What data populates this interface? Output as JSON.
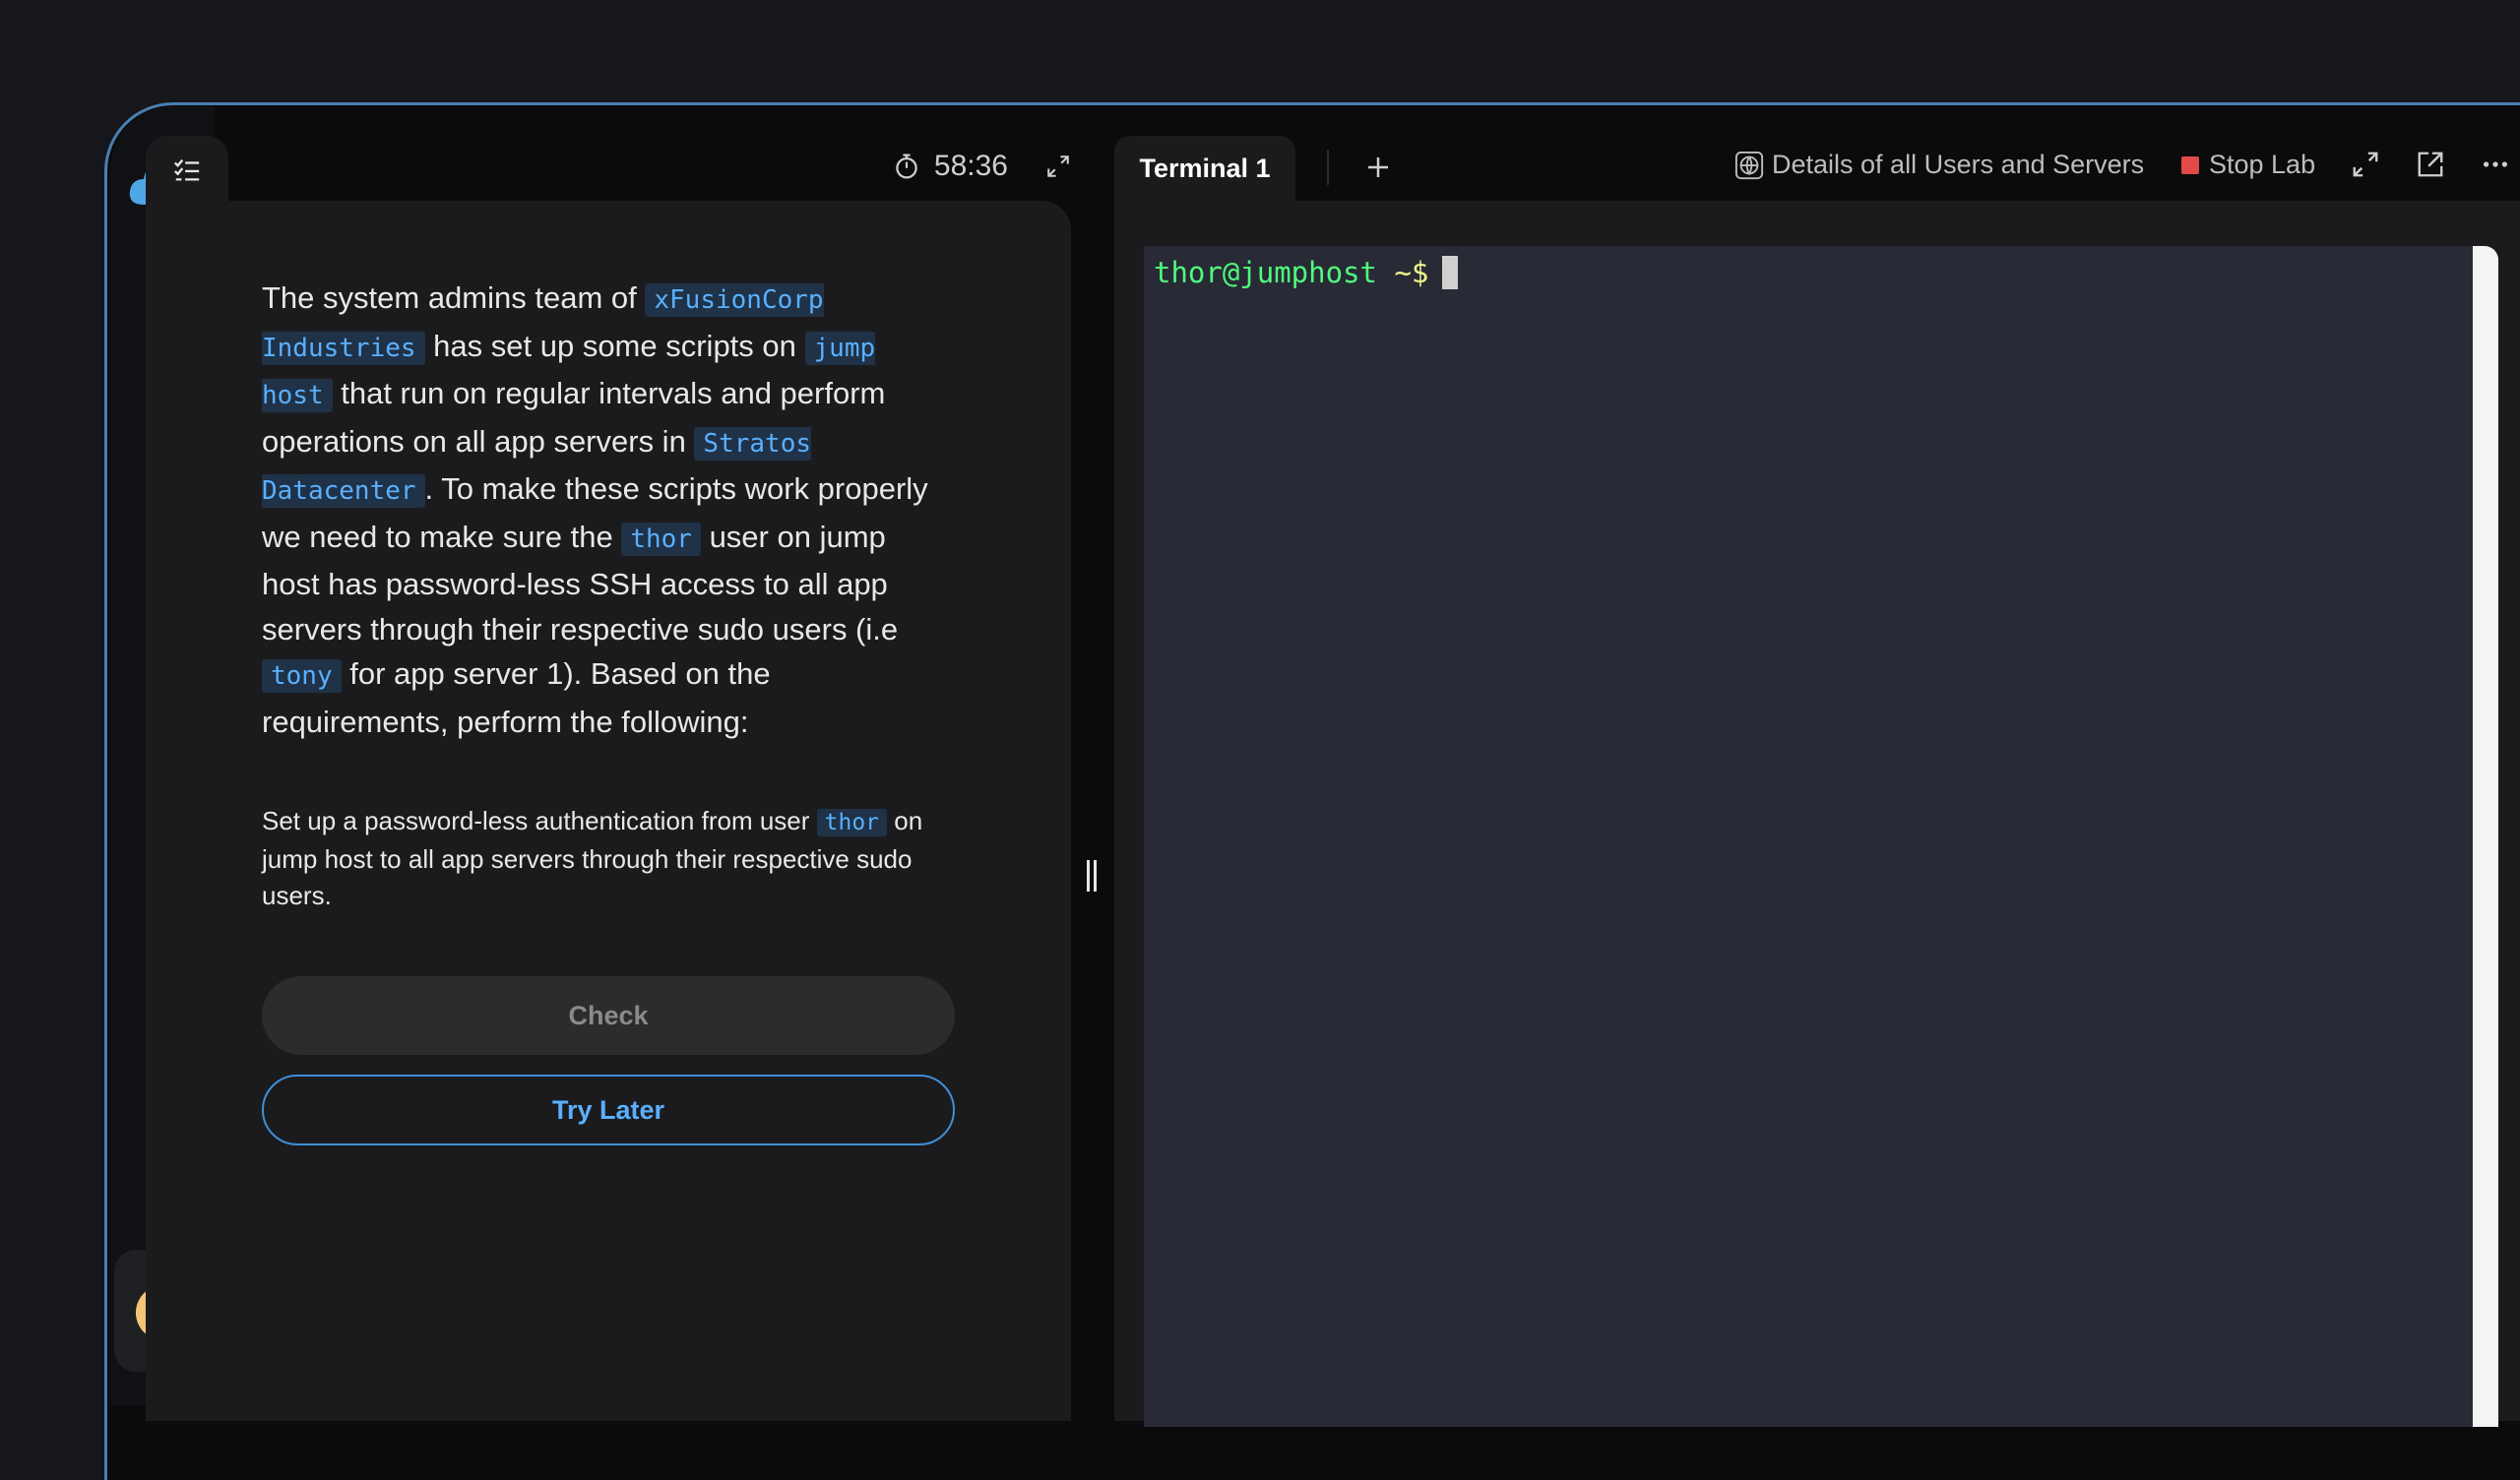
{
  "timer": "58:36",
  "instructions": {
    "segments": [
      {
        "t": "The system admins team of "
      },
      {
        "c": "xFusionCorp Industries"
      },
      {
        "t": " has set up some scripts on "
      },
      {
        "c": "jump host"
      },
      {
        "t": " that run on regular intervals and perform operations on all app servers in "
      },
      {
        "c": "Stratos Datacenter"
      },
      {
        "t": ". To make these scripts work properly we need to make sure the "
      },
      {
        "c": "thor"
      },
      {
        "t": " user on jump host has password-less SSH access to all app servers through their respective sudo users (i.e "
      },
      {
        "c": "tony"
      },
      {
        "t": " for app server 1). Based on the requirements, perform the following:"
      }
    ]
  },
  "task": {
    "segments": [
      {
        "t": "Set up a password-less authentication from user "
      },
      {
        "c": "thor"
      },
      {
        "t": " on jump host to all app servers through their respective sudo users."
      }
    ]
  },
  "buttons": {
    "check": "Check",
    "try_later": "Try Later"
  },
  "terminal": {
    "tab_label": "Terminal 1",
    "prompt_user": "thor@jumphost",
    "prompt_symbol": " ~$"
  },
  "toolbar": {
    "details": "Details of all Users and Servers",
    "stop_lab": "Stop Lab"
  },
  "colors": {
    "accent": "#3f8fd6",
    "code_text": "#5ab0ff",
    "code_bg": "#1f3247",
    "stop": "#e24a4a",
    "terminal_bg": "#282a36",
    "prompt_green": "#50fa7b"
  },
  "sidebar": {
    "icons": [
      "home-icon",
      "path-icon",
      "chart-icon",
      "ticket-icon",
      "leaderboard-icon",
      "feedback-icon",
      "info-icon",
      "book-icon"
    ]
  }
}
